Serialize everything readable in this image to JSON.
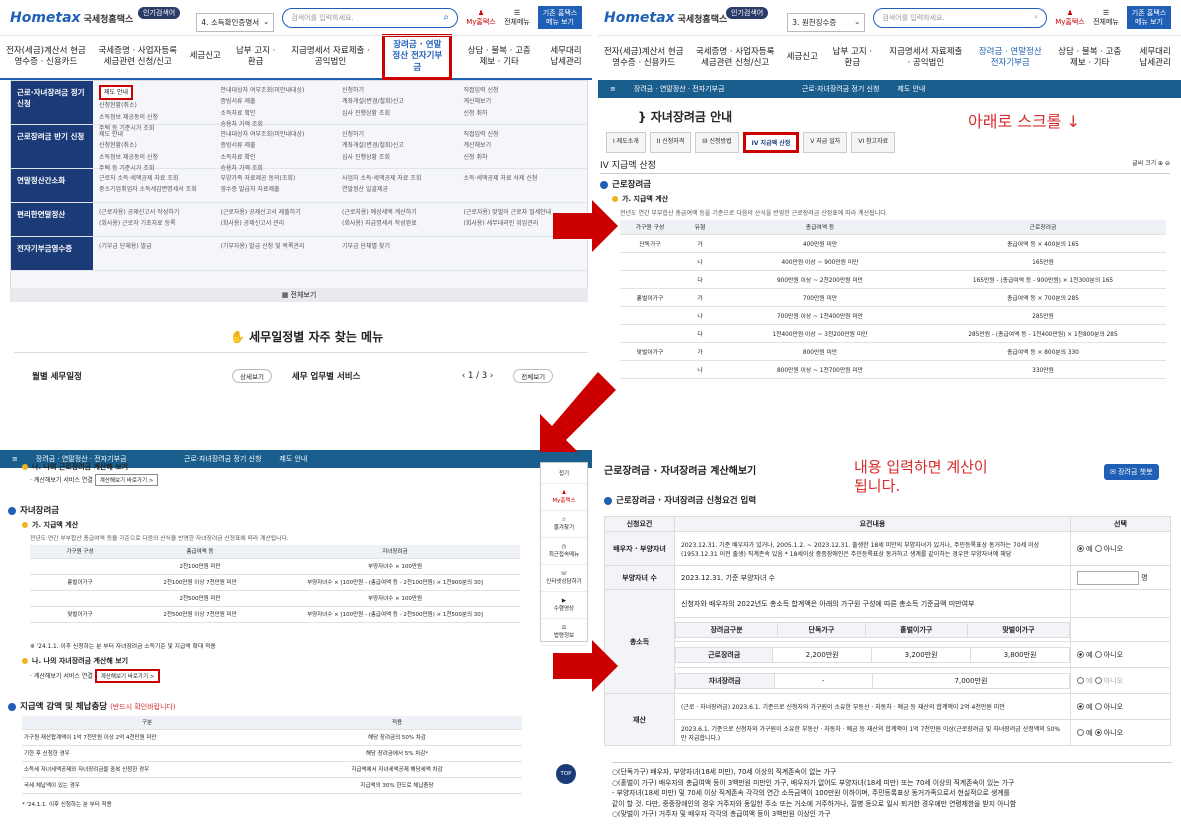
{
  "header": {
    "logo": "Hometax",
    "logo_sub": "국세청홈택스",
    "popular_badge": "인기검색어",
    "search_placeholder": "검색어를 입력하세요.",
    "my_label": "My홈택스",
    "all_menu": "전체메뉴",
    "basic_view": "기존 홈택스 메뉴 보기"
  },
  "q1": {
    "popular_item": "4. 소득확인증명서",
    "nav": [
      "전자(세금)계산서 현금영수증 · 신용카드",
      "국세증명 · 사업자등록 세금관련 신청/신고",
      "세금신고",
      "납부 고지 · 환급",
      "지급명세서 자료제출 · 공익법인",
      "장려금 · 연말정산 전자기부금",
      "상담 · 불복 · 고충 제보 · 기타",
      "세무대리 납세관리"
    ],
    "menu": [
      {
        "title": "근로·자녀장려금 정기 신청",
        "c1": [
          "제도 안내",
          "신청현황(취소)",
          "소득정보 제공동의 신청",
          "주택 등 기준시가 조회"
        ],
        "c2": [
          "안내대상자 여부조회(미안내대상)",
          "증빙서류 제출",
          "소득자료 확인",
          "승용차 가액 조회"
        ],
        "c3": [
          "신청하기",
          "계좌개설(변경/철회)신고",
          "심사 진행상황 조회"
        ],
        "c4": [
          "직접입력 신청",
          "계산해보기",
          "신청 취하"
        ]
      },
      {
        "title": "근로장려금 반기 신청",
        "c1": [
          "제도 안내",
          "신청현황(취소)",
          "소득정보 제공동의 신청",
          "주택 등 기준시가 조회"
        ],
        "c2": [
          "안내대상자 여부조회(미안내대상)",
          "증빙서류 제출",
          "소득자료 확인",
          "승용차 가액 조회"
        ],
        "c3": [
          "신청하기",
          "계좌개설(변경/철회)신고",
          "심사 진행상황 조회"
        ],
        "c4": [
          "직접입력 신청",
          "계산해보기",
          "신청 취하"
        ]
      },
      {
        "title": "연말정산간소화",
        "c1": [
          "근로자 소득·세액공제 자료 조회",
          "중소기업취업자 소득세감면명세서 조회"
        ],
        "c2": [
          "부양가족 자료제공 동의(조회)",
          "영수증 발급처 자료제출"
        ],
        "c3": [
          "사업자 소득·세액공제 자료 조회",
          "연말정산 일괄제공"
        ],
        "c4": [
          "소득·세액공제 자료 삭제 신청"
        ]
      },
      {
        "title": "편리한연말정산",
        "c1": [
          "(근로자용) 공제신고서 작성하기",
          "(회사용) 근로자 기초자료 등록"
        ],
        "c2": [
          "(근로자용) 공제신고서 제출하기",
          "(회사용) 공제신고서 관리"
        ],
        "c3": [
          "(근로자용) 예상세액 계산하기",
          "(회사용) 지급명세서 작성완료"
        ],
        "c4": [
          "(근로자용) 맞벌이 근로자 절세안내",
          "(회사용) 세무대리인 위임관리"
        ]
      },
      {
        "title": "전자기부금영수증",
        "c1": [
          "(기부금 단체용) 발급"
        ],
        "c2": [
          "(기부자용) 발급 신청 및 목록관리"
        ],
        "c3": [
          "기부금 단체별 찾기"
        ],
        "c4": []
      }
    ],
    "all_view": "전체보기",
    "faq_title": "세무일정별 자주 찾는 메뉴",
    "monthly": "월별 세무일정",
    "detail": "상세보기",
    "service": "세무 업무별 서비스",
    "page": "1 / 3",
    "all_view2": "전체보기"
  },
  "q2": {
    "popular_item": "3. 원천징수증",
    "crumb1": "장려금 · 연말정산 · 전자기부금",
    "crumb2": "근로·자녀장려금 정기 신청",
    "crumb3": "제도 안내",
    "title": "자녀장려금 안내",
    "scroll_note": "아래로 스크롤 ↓",
    "tabs": [
      "I 제도소개",
      "II 신청자격",
      "III 신청방법",
      "IV 지급액 산정",
      "V 지급 일자",
      "VI 참고자료"
    ],
    "sec": "IV 지급액 산정",
    "font": "글씨 크기",
    "sub": "근로장려금",
    "sub2": "가. 지급액 계산",
    "desc": "전년도 연간 부부합산 총급여액 등을 기준으로 다음의 산식을 반영한 근로장려금 산정표에 따라 계산됩니다.",
    "head": [
      "가구원 구성",
      "유형",
      "총급여액 등",
      "근로장려금"
    ],
    "rows": [
      [
        "단독가구",
        "가",
        "400만원 미만",
        "총급여액 등 × 400분의 165"
      ],
      [
        "",
        "나",
        "400만원 이상 ~ 900만원 미만",
        "165만원"
      ],
      [
        "",
        "다",
        "900만원 이상 ~ 2천200만원 미만",
        "165만원 - (총급여액 등 - 900만원) × 1천300분의 165"
      ],
      [
        "홑벌이가구",
        "가",
        "700만원 미만",
        "총급여액 등 × 700분의 285"
      ],
      [
        "",
        "나",
        "700만원 이상 ~ 1천400만원 미만",
        "285만원"
      ],
      [
        "",
        "다",
        "1천400만원 이상 ~ 3천200만원 미만",
        "285만원 - (총급여액 등 - 1천400만원) × 1천800분의 285"
      ],
      [
        "맞벌이가구",
        "가",
        "800만원 미만",
        "총급여액 등 × 800분의 330"
      ],
      [
        "",
        "나",
        "800만원 이상 ~ 1천700만원 미만",
        "330만원"
      ]
    ]
  },
  "q3": {
    "n1": "나. 나의 근로장려금 계산해 보기",
    "link": "계산해보기 서비스 연결",
    "btn": "계산해보기 바로가기 >",
    "sec": "자녀장려금",
    "sub": "가. 지급액 계산",
    "desc": "전년도 연간 부부합산 총급여액 등을 기준으로 다음의 산식을 반영한 자녀장려금 산정표에 따라 계산됩니다.",
    "head": [
      "가구원 구성",
      "총급여액 등",
      "자녀장려금"
    ],
    "rows": [
      [
        "",
        "2천100만원 미만",
        "부양자녀수 × 100만원"
      ],
      [
        "홑벌이가구",
        "2천100만원 이상 7천만원 미만",
        "부양자녀수 × [100만원 - (총급여액 등 - 2천100만원) × 1천900분의 30]"
      ],
      [
        "",
        "2천500만원 미만",
        "부양자녀수 × 100만원"
      ],
      [
        "맞벌이가구",
        "2천500만원 이상 7천만원 미만",
        "부양자녀수 × [100만원 - (총급여액 등 - 2천500만원) × 1천500분의 30]"
      ]
    ],
    "note": "※ '24.1.1. 이후 신청하는 분 부터 자녀장려금 소득기준 및 지급액 확대 적용",
    "n2": "나. 나의 자녀장려금 계산해 보기",
    "sec2": "지급액 감액 및 체납충당",
    "sec2b": "(반드시 확인바랍니다)",
    "head2": [
      "구분",
      "적용"
    ],
    "rows2": [
      [
        "가구원 재산합계액이 1억 7천만원 이상 2억 4천만원 미만",
        "해당 장려금의 50% 차감"
      ],
      [
        "기한 후 신청한 경우",
        "해당 장려금에서 5% 차감*"
      ],
      [
        "소득세 자녀세액공제와 자녀장려금을 중복 신청한 경우",
        "지급액에서 자녀세액공제 해당세액 차감"
      ],
      [
        "국세 체납액이 있는 경우",
        "지급액의 30% 한도로 체납충당"
      ]
    ],
    "foot": "* '24.1.1. 이후 신청하는 분 부터 적용",
    "side": [
      "접기",
      "My홈택스",
      "즐겨찾기",
      "최근접속메뉴",
      "인터넷상담하기",
      "수행영상",
      "법령정보"
    ],
    "top": "TOP"
  },
  "q4": {
    "title": "근로장려금 · 자녀장려금 계산해보기",
    "chatbot": "장려금 챗봇",
    "note": "내용 입력하면 계산이 됩니다.",
    "sec": "근로장려금 · 자녀장려금 신청요건 입력",
    "head": [
      "신청요건",
      "요건내용",
      "선택"
    ],
    "spouse_label": "배우자 · 부양자녀",
    "spouse_text": "2023.12.31. 기준 배우자가 있거나, 2005.1.2. ~ 2023.12.31. 출생한 18세 미만의 부양자녀가 있거나, 주민등록표상 동거하는 70세 이상(1953.12.31 이전 출생) 직계존속 있음 * 18세이상 중증장애인은 주민등록표상 동거하고 생계를 같이하는 경우만 부양자녀에 해당",
    "child_label": "부양자녀 수",
    "child_text": "2023.12.31. 기준 부양자녀 수",
    "unit": "명",
    "income_label": "총소득",
    "income_text": "신청자와 배우자의 2022년도 총소득 합계액은 아래의 가구원 구성에 따른 총소득 기준금액 미만여부",
    "ih": [
      "장려금구분",
      "단독가구",
      "홑벌이가구",
      "맞벌이가구"
    ],
    "ir1": [
      "근로장려금",
      "2,200만원",
      "3,200만원",
      "3,800만원"
    ],
    "ir2": [
      "자녀장려금",
      "-",
      "7,000만원"
    ],
    "asset_label": "재산",
    "asset1": "(근로 · 자녀장려금) 2023.6.1. 기준으로 신청자와 가구원이 소유한 부동산 · 자동차 · 예금 등 재산의 합계액이 2억 4천만원 미만",
    "asset2": "2023.6.1. 기준으로 신청자와 가구원이 소유한 부동산 · 자동차 · 예금 등 재산의 합계액이 1억 7천만원 이상(근로장려금 및 자녀장려금 산정액의 50%만 지급합니다.)",
    "yes": "예",
    "no": "아니오",
    "notes": [
      "○(단독가구) 배우자, 부양자녀(18세 미만), 70세 이상의 직계존속이 없는 가구",
      "○(홑벌이 가구) 배우자의 총급여액 등이 3백만원 미만인 가구, 배우자가 없어도 부양자녀(18세 미만) 또는 70세 이상의 직계존속이 있는 가구",
      "- 부양자녀(18세 미만) 및 70세 이상 직계존속 각각의 연간 소득금액이 100만원 이하이며, 주민등록표상 동거가족으로서 현실적으로 생계를",
      "같이 할 것. 다만, 중증장애인의 경우 거주자와 동일한 주소 또는 거소에 거주하거나, 질병 등으로 일시 퇴거한 경우에만 연령제한을 받지 아니함",
      "○(맞벌이 가구) 거주자 및 배우자 각각의 총급여액 등이 3백만원 이상인 가구"
    ]
  }
}
